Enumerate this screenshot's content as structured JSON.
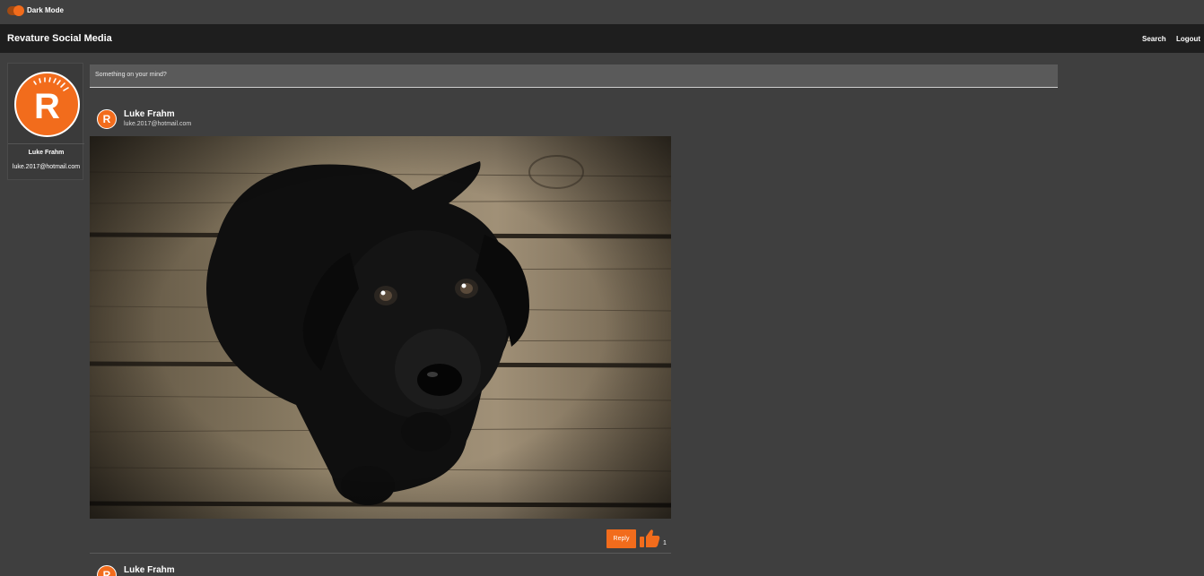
{
  "theme_toggle": {
    "label": "Dark Mode",
    "on": true
  },
  "navbar": {
    "brand": "Revature Social Media",
    "links": {
      "search": "Search",
      "logout": "Logout"
    }
  },
  "profile": {
    "name": "Luke Frahm",
    "email": "luke.2017@hotmail.com",
    "avatar_letter": "R"
  },
  "composer": {
    "placeholder": "Something on your mind?"
  },
  "posts": [
    {
      "author": "Luke Frahm",
      "email": "luke.2017@hotmail.com",
      "avatar_letter": "R",
      "image": "black-labrador-puppy-on-wooden-floor",
      "reply_label": "Reply",
      "likes": "1"
    },
    {
      "author": "Luke Frahm",
      "avatar_letter": "R"
    }
  ],
  "colors": {
    "accent": "#f26c1c",
    "background": "#3f3f3f",
    "navbar": "#1e1e1e"
  }
}
